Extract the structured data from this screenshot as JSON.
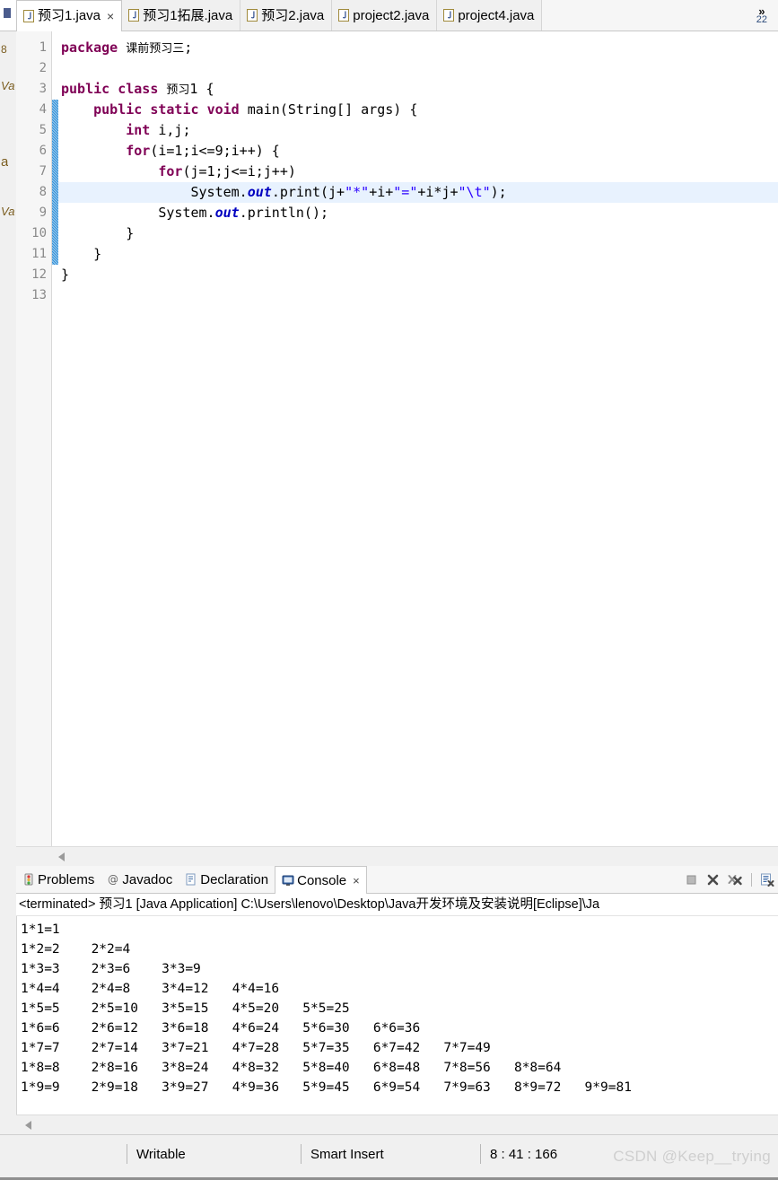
{
  "editor": {
    "tabs": [
      {
        "label": "预习1.java",
        "icon": "java-file-icon",
        "active": true,
        "closable": true
      },
      {
        "label": "预习1拓展.java",
        "icon": "java-file-icon",
        "active": false,
        "closable": false
      },
      {
        "label": "预习2.java",
        "icon": "java-file-icon",
        "active": false,
        "closable": false
      },
      {
        "label": "project2.java",
        "icon": "java-file-icon",
        "active": false,
        "closable": false
      },
      {
        "label": "project4.java",
        "icon": "java-file-icon",
        "active": false,
        "closable": false
      }
    ],
    "overflow": {
      "chevron": "»",
      "count": "22"
    },
    "close_glyph": "×",
    "line_numbers": [
      "1",
      "2",
      "3",
      "4",
      "5",
      "6",
      "7",
      "8",
      "9",
      "10",
      "11",
      "12",
      "13"
    ],
    "fold_marker_line": 4,
    "highlighted_line": 8,
    "change_bar_lines": [
      4,
      11
    ],
    "code_lines": [
      "package 课前预习三;",
      "",
      "public class 预习1 {",
      "    public static void main(String[] args) {",
      "        int i,j;",
      "        for(i=1;i<=9;i++) {",
      "            for(j=1;j<=i;j++)",
      "                System.out.print(j+\"*\"+i+\"=\"+i*j+\"\\t\");",
      "            System.out.println();",
      "        }",
      "    }",
      "}",
      ""
    ],
    "colors": {
      "keyword": "#7f0055",
      "string": "#2a00ff",
      "field": "#0000c0",
      "line_highlight": "#e8f2fe",
      "change_bar": "#2f8fd8"
    }
  },
  "left_sidebar": {
    "fragments": [
      "8",
      "Va",
      "a",
      "Va"
    ]
  },
  "console": {
    "tabs": [
      {
        "label": "Problems",
        "icon": "problems-icon",
        "active": false
      },
      {
        "label": "Javadoc",
        "icon": "javadoc-icon",
        "active": false
      },
      {
        "label": "Declaration",
        "icon": "declaration-icon",
        "active": false
      },
      {
        "label": "Console",
        "icon": "console-icon",
        "active": true
      }
    ],
    "close_glyph": "×",
    "toolbar_icons": [
      "terminate-icon",
      "remove-launch-icon",
      "remove-all-terminated-icon",
      "clear-console-icon"
    ],
    "launch_header": "<terminated> 预习1 [Java Application] C:\\Users\\lenovo\\Desktop\\Java开发环境及安装说明[Eclipse]\\Ja",
    "output_lines": [
      "1*1=1",
      "1*2=2    2*2=4",
      "1*3=3    2*3=6    3*3=9",
      "1*4=4    2*4=8    3*4=12   4*4=16",
      "1*5=5    2*5=10   3*5=15   4*5=20   5*5=25",
      "1*6=6    2*6=12   3*6=18   4*6=24   5*6=30   6*6=36",
      "1*7=7    2*7=14   3*7=21   4*7=28   5*7=35   6*7=42   7*7=49",
      "1*8=8    2*8=16   3*8=24   4*8=32   5*8=40   6*8=48   7*8=56   8*8=64",
      "1*9=9    2*9=18   3*9=27   4*9=36   5*9=45   6*9=54   7*9=63   8*9=72   9*9=81"
    ]
  },
  "statusbar": {
    "writable": "Writable",
    "insert_mode": "Smart Insert",
    "position": "8 : 41 : 166",
    "watermark": "CSDN @Keep__trying"
  }
}
